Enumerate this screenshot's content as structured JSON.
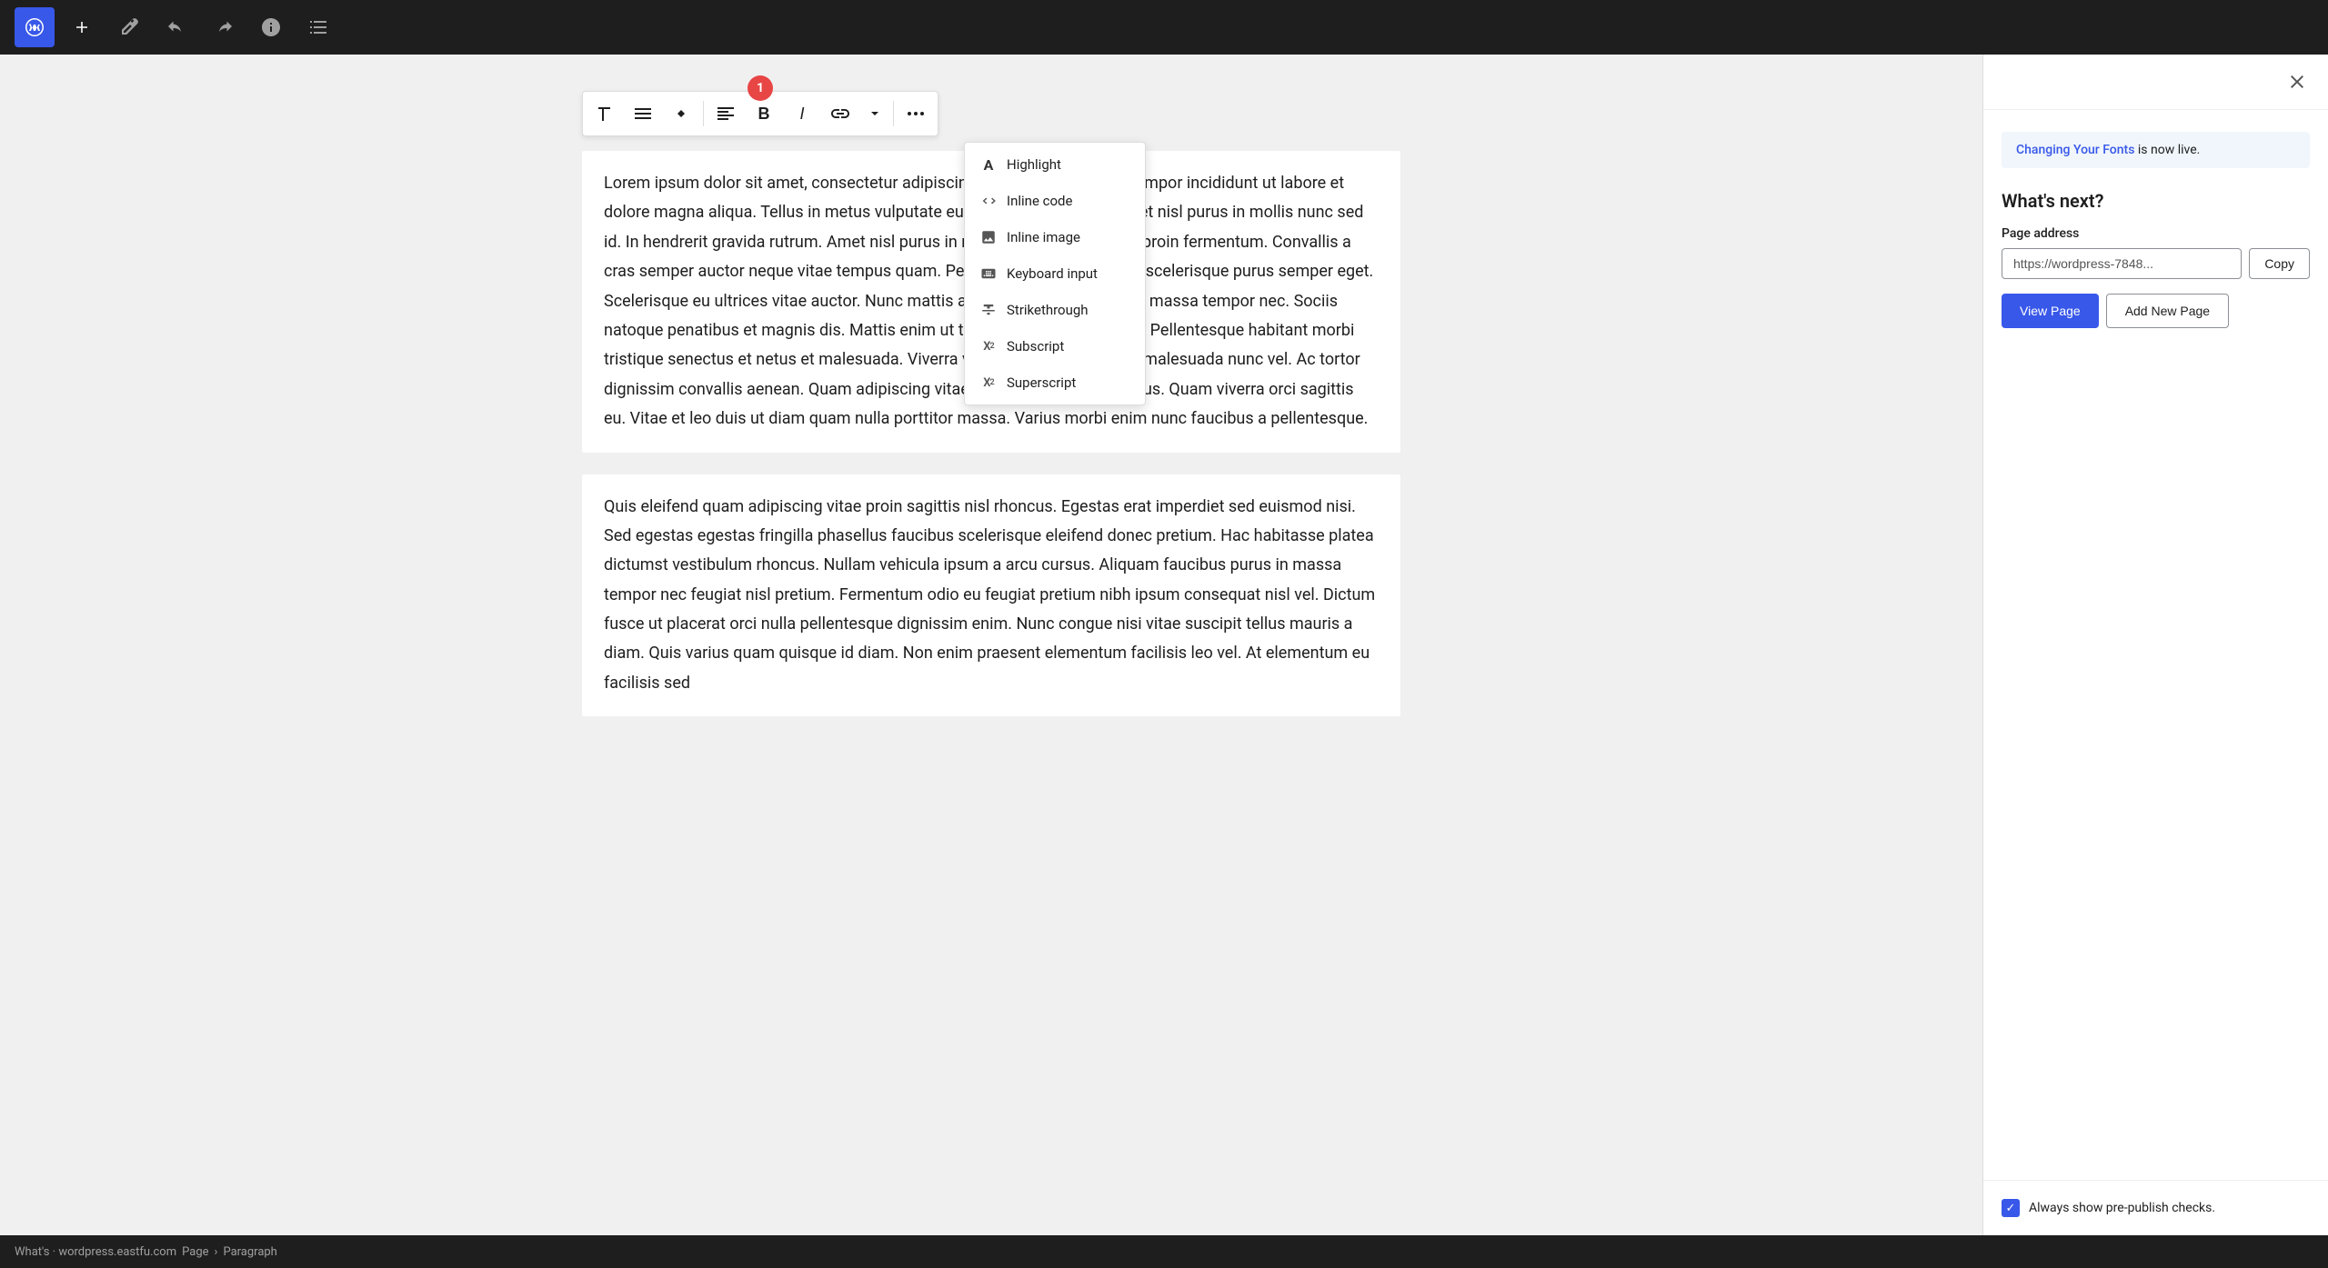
{
  "topbar": {
    "logo_label": "W",
    "add_button_title": "Add new block",
    "edit_button_title": "Edit",
    "undo_button_title": "Undo",
    "redo_button_title": "Redo",
    "info_button_title": "View details",
    "list_view_title": "List view"
  },
  "block_toolbar": {
    "notification_count": "1",
    "paragraph_icon_title": "Paragraph",
    "list_icon_title": "List",
    "move_icon_title": "Move",
    "align_icon_title": "Align",
    "bold_title": "Bold",
    "italic_title": "Italic",
    "link_title": "Link",
    "dropdown_title": "More options",
    "more_title": "More"
  },
  "dropdown_menu": {
    "items": [
      {
        "id": "highlight",
        "label": "Highlight",
        "icon": "A"
      },
      {
        "id": "inline-code",
        "label": "Inline code",
        "icon": "<>"
      },
      {
        "id": "inline-image",
        "label": "Inline image",
        "icon": "img"
      },
      {
        "id": "keyboard-input",
        "label": "Keyboard input",
        "icon": "kbd"
      },
      {
        "id": "strikethrough",
        "label": "Strikethrough",
        "icon": "S"
      },
      {
        "id": "subscript",
        "label": "Subscript",
        "icon": "X₂"
      },
      {
        "id": "superscript",
        "label": "Superscript",
        "icon": "X²"
      }
    ]
  },
  "editor": {
    "paragraph1": "Lorem ipsum dolor sit amet, consectetur adipiscing elit, sed do eiusmod tempor incididunt ut labore et dolore magna aliqua. Tellus in metus vulputate eu scelerisque feugiat. Amet nisl purus in mollis nunc sed id. In hendrerit gravida rutrum. Amet nisl purus in mollis nunc sed. Feugiat proin fermentum. Convallis a cras semper auctor neque vitae tempus quam. Pellentesque sagittis orci a scelerisque purus semper eget. Scelerisque eu ultrices vitae auctor. Nunc mattis aliquam faucibus purus in massa tempor nec. Sociis natoque penatibus et magnis dis. Mattis enim ut tellus elementum sagittis. Pellentesque habitant morbi tristique senectus et netus et malesuada. Viverra vitae ultricies leo integer malesuada nunc vel. Ac tortor dignissim convallis aenean. Quam adipiscing vitae proin sagittis nisl rhoncus. Quam viverra orci sagittis eu. Vitae et leo duis ut diam quam nulla porttitor massa. Varius morbi enim nunc faucibus a pellentesque.",
    "paragraph2": "Quis eleifend quam adipiscing vitae proin sagittis nisl rhoncus. Egestas erat imperdiet sed euismod nisi. Sed egestas egestas fringilla phasellus faucibus scelerisque eleifend donec pretium. Hac habitasse platea dictumst vestibulum rhoncus. Nullam vehicula ipsum a arcu cursus. Aliquam faucibus purus in massa tempor nec feugiat nisl pretium. Fermentum odio eu feugiat pretium nibh ipsum consequat nisl vel. Dictum fusce ut placerat orci nulla pellentesque dignissim enim. Nunc congue nisi vitae suscipit tellus mauris a diam. Quis varius quam quisque id diam. Non enim praesent elementum facilisis leo vel. At elementum eu facilisis sed"
  },
  "sidebar": {
    "notification": {
      "text": "Changing Your Fonts",
      "suffix": " is now live."
    },
    "what_next_title": "What's next?",
    "page_address_label": "Page address",
    "page_address_value": "https://wordpress-7848...",
    "copy_button_label": "Copy",
    "view_page_label": "View Page",
    "add_new_page_label": "Add New Page",
    "pre_publish_label": "Always show pre-publish checks."
  },
  "footer": {
    "site_label": "What's · wordpress.eastfu.com",
    "breadcrumb": {
      "page": "Page",
      "separator": "›",
      "paragraph": "Paragraph"
    }
  }
}
